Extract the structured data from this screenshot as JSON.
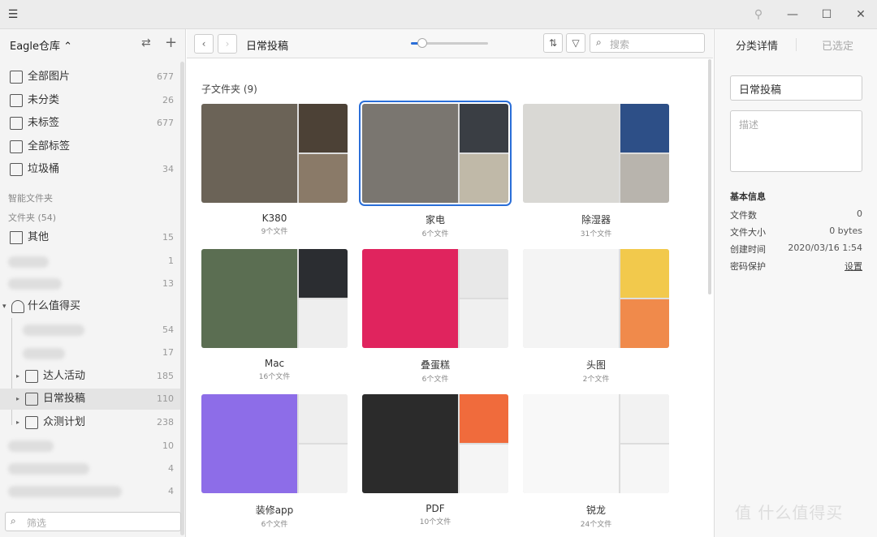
{
  "window": {
    "menu_icon": "hamburger-icon",
    "pin_icon": "pin-icon",
    "minimize": "—",
    "maximize": "☐",
    "close": "✕"
  },
  "sidebar": {
    "library": "Eagle仓库 ⌃",
    "items": [
      {
        "label": "全部图片",
        "count": "677"
      },
      {
        "label": "未分类",
        "count": "26"
      },
      {
        "label": "未标签",
        "count": "677"
      },
      {
        "label": "全部标签",
        "count": ""
      },
      {
        "label": "垃圾桶",
        "count": "34"
      }
    ],
    "smart_folders": "智能文件夹",
    "folders_header": "文件夹 (54)",
    "folder_other": {
      "label": "其他",
      "count": "15"
    },
    "blurred_counts": [
      "1",
      "13"
    ],
    "zdm": {
      "label": "什么值得买"
    },
    "zdm_blurred_counts": [
      "54",
      "17"
    ],
    "children": [
      {
        "label": "达人活动",
        "count": "185"
      },
      {
        "label": "日常投稿",
        "count": "110"
      },
      {
        "label": "众测计划",
        "count": "238"
      }
    ],
    "bottom_blurred_counts": [
      "10",
      "4",
      "4"
    ],
    "search_placeholder": "筛选"
  },
  "toolbar": {
    "back": "‹",
    "forward": "›",
    "breadcrumb": "日常投稿",
    "zoom": 0.15,
    "sort_icon": "sort-icon",
    "filter_icon": "filter-icon",
    "search_placeholder": "搜索"
  },
  "main": {
    "subfolders_title": "子文件夹 (9)",
    "folders": [
      {
        "name": "K380",
        "count": "9个文件",
        "colors": [
          "#6b6357",
          "#4c4136",
          "#8a7a68"
        ]
      },
      {
        "name": "家电",
        "count": "6个文件",
        "colors": [
          "#7a7670",
          "#3a3e44",
          "#c0b9a8"
        ]
      },
      {
        "name": "除湿器",
        "count": "31个文件",
        "colors": [
          "#d9d8d4",
          "#2d4f87",
          "#b8b4ad"
        ]
      },
      {
        "name": "Mac",
        "count": "16个文件",
        "colors": [
          "#5b6e52",
          "#2b2d31",
          "#eeeeee"
        ]
      },
      {
        "name": "叠蛋糕",
        "count": "6个文件",
        "colors": [
          "#e0245e",
          "#e8e8e8",
          "#f0f0f0"
        ]
      },
      {
        "name": "头图",
        "count": "2个文件",
        "colors": [
          "#f4f4f4",
          "#f2c94c",
          "#f08a4b"
        ]
      },
      {
        "name": "装修app",
        "count": "6个文件",
        "colors": [
          "#8d6de8",
          "#eeeeee",
          "#f2f2f2"
        ]
      },
      {
        "name": "PDF",
        "count": "10个文件",
        "colors": [
          "#2b2b2b",
          "#f06b3c",
          "#f5f5f5"
        ]
      },
      {
        "name": "锐龙",
        "count": "24个文件",
        "colors": [
          "#f8f8f8",
          "#f2f2f2",
          "#f6f6f6"
        ]
      }
    ]
  },
  "right_panel": {
    "tab_details": "分类详情",
    "tab_selected": "已选定",
    "name_value": "日常投稿",
    "desc_placeholder": "描述",
    "info_title": "基本信息",
    "rows": [
      {
        "label": "文件数",
        "value": "0"
      },
      {
        "label": "文件大小",
        "value": "0 bytes"
      },
      {
        "label": "创建时间",
        "value": "2020/03/16 1:54"
      },
      {
        "label": "密码保护",
        "value": "设置"
      }
    ]
  },
  "watermark": "值 什么值得买"
}
